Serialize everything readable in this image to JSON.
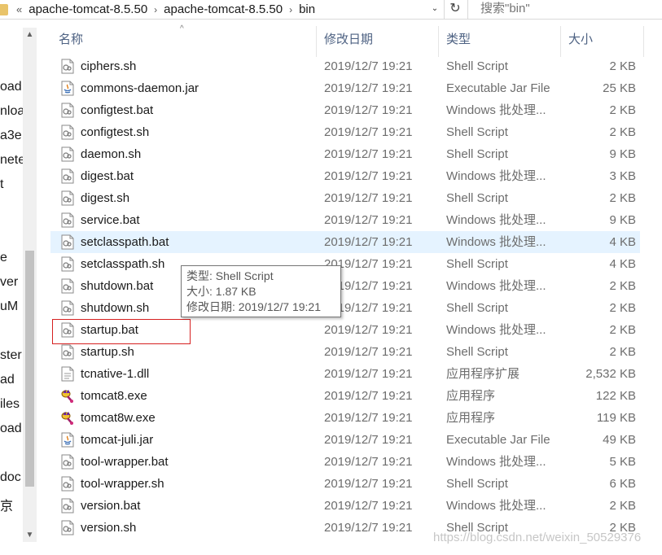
{
  "address_bar": {
    "overflow": "«",
    "crumbs": [
      "apache-tomcat-8.5.50",
      "apache-tomcat-8.5.50",
      "bin"
    ],
    "separator": "›",
    "dropdown": "⌄",
    "refresh": "↻",
    "search_placeholder": "搜索\"bin\""
  },
  "nav_pane": {
    "items": [
      "oad",
      "nloa",
      "a3e",
      "nete",
      "t",
      "e",
      "ver",
      "uM",
      "ster",
      "ad",
      "iles",
      "oad",
      "doc",
      "京"
    ]
  },
  "columns": {
    "name": "名称",
    "date": "修改日期",
    "type": "类型",
    "size": "大小",
    "sort_indicator": "^"
  },
  "files": [
    {
      "name": "ciphers.sh",
      "date": "2019/12/7 19:21",
      "type": "Shell Script",
      "size": "2 KB",
      "icon": "script-icon"
    },
    {
      "name": "commons-daemon.jar",
      "date": "2019/12/7 19:21",
      "type": "Executable Jar File",
      "size": "25 KB",
      "icon": "java-jar-icon"
    },
    {
      "name": "configtest.bat",
      "date": "2019/12/7 19:21",
      "type": "Windows 批处理...",
      "size": "2 KB",
      "icon": "script-icon"
    },
    {
      "name": "configtest.sh",
      "date": "2019/12/7 19:21",
      "type": "Shell Script",
      "size": "2 KB",
      "icon": "script-icon"
    },
    {
      "name": "daemon.sh",
      "date": "2019/12/7 19:21",
      "type": "Shell Script",
      "size": "9 KB",
      "icon": "script-icon"
    },
    {
      "name": "digest.bat",
      "date": "2019/12/7 19:21",
      "type": "Windows 批处理...",
      "size": "3 KB",
      "icon": "script-icon"
    },
    {
      "name": "digest.sh",
      "date": "2019/12/7 19:21",
      "type": "Shell Script",
      "size": "2 KB",
      "icon": "script-icon"
    },
    {
      "name": "service.bat",
      "date": "2019/12/7 19:21",
      "type": "Windows 批处理...",
      "size": "9 KB",
      "icon": "script-icon"
    },
    {
      "name": "setclasspath.bat",
      "date": "2019/12/7 19:21",
      "type": "Windows 批处理...",
      "size": "4 KB",
      "icon": "script-icon"
    },
    {
      "name": "setclasspath.sh",
      "date": "2019/12/7 19:21",
      "type": "Shell Script",
      "size": "4 KB",
      "icon": "script-icon"
    },
    {
      "name": "shutdown.bat",
      "date": "2019/12/7 19:21",
      "type": "Windows 批处理...",
      "size": "2 KB",
      "icon": "script-icon"
    },
    {
      "name": "shutdown.sh",
      "date": "2019/12/7 19:21",
      "type": "Shell Script",
      "size": "2 KB",
      "icon": "script-icon"
    },
    {
      "name": "startup.bat",
      "date": "2019/12/7 19:21",
      "type": "Windows 批处理...",
      "size": "2 KB",
      "icon": "script-icon"
    },
    {
      "name": "startup.sh",
      "date": "2019/12/7 19:21",
      "type": "Shell Script",
      "size": "2 KB",
      "icon": "script-icon"
    },
    {
      "name": "tcnative-1.dll",
      "date": "2019/12/7 19:21",
      "type": "应用程序扩展",
      "size": "2,532 KB",
      "icon": "dll-icon"
    },
    {
      "name": "tomcat8.exe",
      "date": "2019/12/7 19:21",
      "type": "应用程序",
      "size": "122 KB",
      "icon": "tomcat-exe-icon"
    },
    {
      "name": "tomcat8w.exe",
      "date": "2019/12/7 19:21",
      "type": "应用程序",
      "size": "119 KB",
      "icon": "tomcat-exe-icon"
    },
    {
      "name": "tomcat-juli.jar",
      "date": "2019/12/7 19:21",
      "type": "Executable Jar File",
      "size": "49 KB",
      "icon": "java-jar-icon"
    },
    {
      "name": "tool-wrapper.bat",
      "date": "2019/12/7 19:21",
      "type": "Windows 批处理...",
      "size": "5 KB",
      "icon": "script-icon"
    },
    {
      "name": "tool-wrapper.sh",
      "date": "2019/12/7 19:21",
      "type": "Shell Script",
      "size": "6 KB",
      "icon": "script-icon"
    },
    {
      "name": "version.bat",
      "date": "2019/12/7 19:21",
      "type": "Windows 批处理...",
      "size": "2 KB",
      "icon": "script-icon"
    },
    {
      "name": "version.sh",
      "date": "2019/12/7 19:21",
      "type": "Shell Script",
      "size": "2 KB",
      "icon": "script-icon"
    }
  ],
  "tooltip": {
    "line1": "类型: Shell Script",
    "line2": "大小: 1.87 KB",
    "line3": "修改日期: 2019/12/7 19:21"
  },
  "watermark": "https://blog.csdn.net/weixin_50529376",
  "colors": {
    "hover_row": "#e5f3ff",
    "highlight_box": "#d62020",
    "header_text": "#4d6182",
    "meta_text": "#6d6d6d"
  }
}
